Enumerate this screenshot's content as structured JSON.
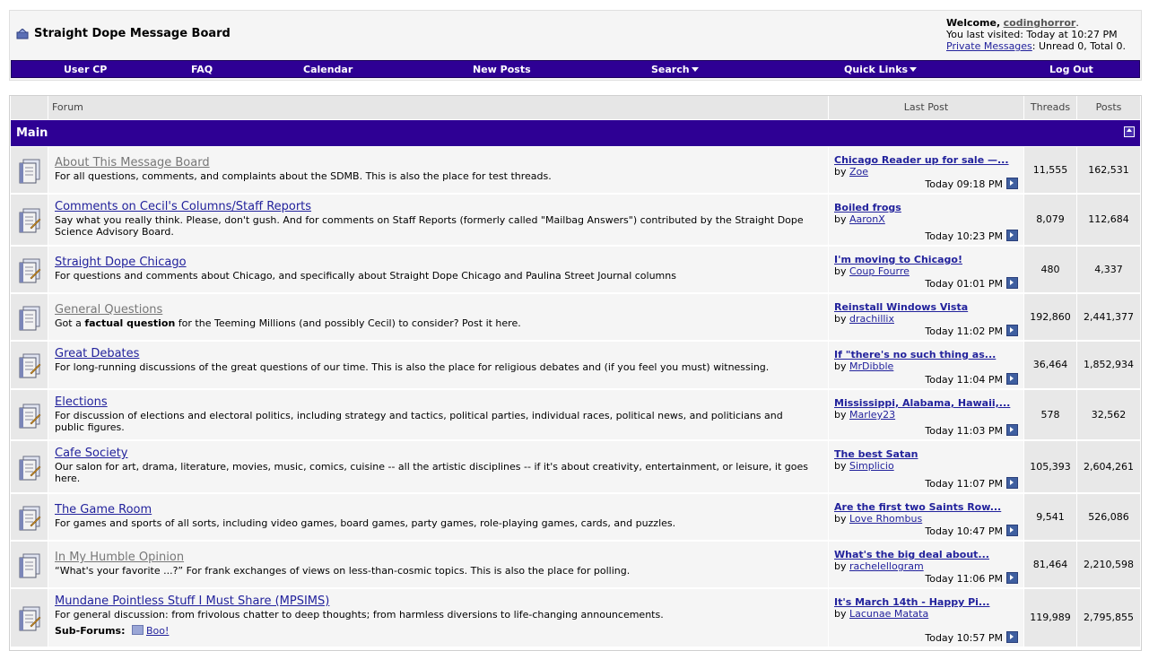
{
  "header": {
    "site_title": "Straight Dope Message Board",
    "welcome_label": "Welcome,",
    "username": "codinghorror",
    "last_visited": "You last visited: Today at 10:27 PM",
    "pm_label": "Private Messages",
    "pm_status": ": Unread 0, Total 0."
  },
  "nav": {
    "user_cp": "User CP",
    "faq": "FAQ",
    "calendar": "Calendar",
    "new_posts": "New Posts",
    "search": "Search",
    "quick_links": "Quick Links",
    "log_out": "Log Out"
  },
  "columns": {
    "forum": "Forum",
    "last_post": "Last Post",
    "threads": "Threads",
    "posts": "Posts"
  },
  "category": {
    "name": "Main"
  },
  "forums": [
    {
      "title": "About This Message Board",
      "status": "read",
      "description": "For all questions, comments, and complaints about the SDMB. This is also the place for test threads.",
      "last_post_title": "Chicago Reader up for sale —...",
      "last_post_by": "Zoe",
      "last_post_time": "Today 09:18 PM",
      "threads": "11,555",
      "posts": "162,531"
    },
    {
      "title": "Comments on Cecil's Columns/Staff Reports",
      "status": "unread",
      "description": "Say what you really think. Please, don't gush. And for comments on Staff Reports (formerly called \"Mailbag Answers\") contributed by the Straight Dope Science Advisory Board.",
      "last_post_title": "Boiled frogs",
      "last_post_by": "AaronX",
      "last_post_time": "Today 10:23 PM",
      "threads": "8,079",
      "posts": "112,684"
    },
    {
      "title": "Straight Dope Chicago",
      "status": "unread",
      "description": "For questions and comments about Chicago, and specifically about Straight Dope Chicago and Paulina Street Journal columns",
      "last_post_title": "I'm moving to Chicago!",
      "last_post_by": "Coup Fourre",
      "last_post_time": "Today 01:01 PM",
      "threads": "480",
      "posts": "4,337"
    },
    {
      "title": "General Questions",
      "status": "read",
      "description_pre": "Got a ",
      "description_bold": "factual question",
      "description_post": " for the Teeming Millions (and possibly Cecil) to consider? Post it here.",
      "last_post_title": "Reinstall Windows Vista",
      "last_post_by": "drachillix",
      "last_post_time": "Today 11:02 PM",
      "threads": "192,860",
      "posts": "2,441,377"
    },
    {
      "title": "Great Debates",
      "status": "unread",
      "description": "For long-running discussions of the great questions of our time. This is also the place for religious debates and (if you feel you must) witnessing.",
      "last_post_title": "If \"there's no such thing as...",
      "last_post_by": "MrDibble",
      "last_post_time": "Today 11:04 PM",
      "threads": "36,464",
      "posts": "1,852,934"
    },
    {
      "title": "Elections",
      "status": "unread",
      "description": "For discussion of elections and electoral politics, including strategy and tactics, political parties, individual races, political news, and politicians and public figures.",
      "last_post_title": "Mississippi, Alabama, Hawaii,...",
      "last_post_by": "Marley23",
      "last_post_time": "Today 11:03 PM",
      "threads": "578",
      "posts": "32,562"
    },
    {
      "title": "Cafe Society",
      "status": "unread",
      "description": "Our salon for art, drama, literature, movies, music, comics, cuisine -- all the artistic disciplines -- if it's about creativity, entertainment, or leisure, it goes here.",
      "last_post_title": "The best Satan",
      "last_post_by": "Simplicio",
      "last_post_time": "Today 11:07 PM",
      "threads": "105,393",
      "posts": "2,604,261"
    },
    {
      "title": "The Game Room",
      "status": "unread",
      "description": "For games and sports of all sorts, including video games, board games, party games, role-playing games, cards, and puzzles.",
      "last_post_title": "Are the first two Saints Row...",
      "last_post_by": "Love Rhombus",
      "last_post_time": "Today 10:47 PM",
      "threads": "9,541",
      "posts": "526,086"
    },
    {
      "title": "In My Humble Opinion",
      "status": "read",
      "description": "“What's your favorite ...?” For frank exchanges of views on less-than-cosmic topics. This is also the place for polling.",
      "last_post_title": "What's the big deal about...",
      "last_post_by": "rachelellogram",
      "last_post_time": "Today 11:06 PM",
      "threads": "81,464",
      "posts": "2,210,598"
    },
    {
      "title": "Mundane Pointless Stuff I Must Share (MPSIMS)",
      "status": "unread",
      "description": "For general discussion: from frivolous chatter to deep thoughts; from harmless diversions to life-changing announcements.",
      "subforums_label": "Sub-Forums:",
      "subforum": "Boo!",
      "last_post_title": "It's March 14th - Happy Pi...",
      "last_post_by": "Lacunae Matata",
      "last_post_time": "Today 10:57 PM",
      "threads": "119,989",
      "posts": "2,795,855"
    }
  ],
  "by_label": "by"
}
